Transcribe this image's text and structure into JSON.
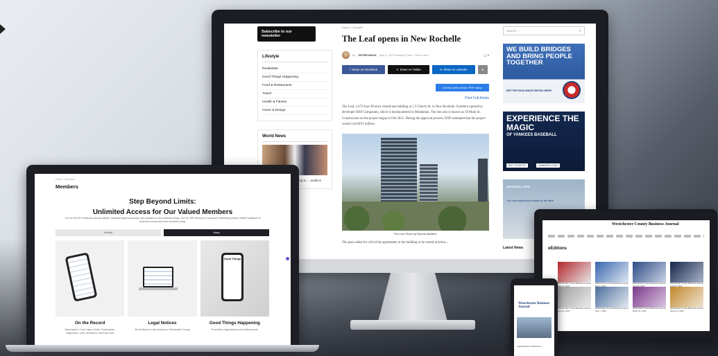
{
  "monitor": {
    "left_col": {
      "newsletter_button": "Subscribe to our newsletter",
      "lifestyle_title": "Lifestyle",
      "lifestyle_items": [
        "Realestate",
        "Good Things Happening",
        "Food & Restaurants",
        "Travel",
        "Health & Fitness",
        "Home & Design"
      ],
      "world_news_title": "World News",
      "world_news_snippet": "? ... how...lutchas ... reaching to ... audition"
    },
    "article": {
      "breadcrumb": "Home > Lifestyle",
      "headline": "The Leaf opens in New Rochelle",
      "byline_by": "By",
      "author": "PETER MAXX",
      "date_meta": "May 6, 2025  Reading Time: 2 mins read",
      "comments": "0",
      "share_facebook": "Share on Facebook",
      "share_twitter": "Share on Twitter",
      "share_linkedin": "Share on LinkedIn",
      "pdf_button": "Get the print version PDF today",
      "print_link": "Print Full Article",
      "paragraph1": "The Leaf, a 475-foot 28-story mixed-use building at 1.5 Church St. in New Rochelle. Southern opened by developer RXP Companies, which is headquartered in Manhattan. The site also is known as 50 Main St. Construction on the project began in Feb 2021. During the approval process, RXP estimated that the project would cost $195 million.",
      "image_caption": "The Leaf. Photo by Express Builders.",
      "paragraph2": "The plan called for 418 of the apartments in the building to be rented at below..."
    },
    "right_col": {
      "search_placeholder": "Search ...",
      "ad1_headline": "WE BUILD BRIDGES AND BRING PEOPLE TOGETHER",
      "ad1_sub": "BETTER BUILDINGS BEGIN HERE",
      "ad2_headline": "EXPERIENCE THE MAGIC",
      "ad2_sub": "OF YANKEES BASEBALL",
      "ad2_btn1": "BUY TICKETS",
      "ad2_btn2": "YANKEES.COM",
      "ad3_brand": "SUPERCELL RED",
      "ad3_sub": "Your new neighborhood awaits for the office",
      "latest_news": "Latest News"
    }
  },
  "laptop": {
    "breadcrumb": "Home > Members",
    "page_title": "Members",
    "headline_line1": "Step Beyond Limits:",
    "headline_line2": "Unlimited Access for Our Valued Members",
    "description": "Join for $19.99 / Business Journal articles, essential legal documents, and updates on new business filings. Join for 20% discount on exclusive networking events, limited invitations to exclusive events and more members today.",
    "tab_monthly": "Monthly",
    "tab_yearly": "Yearly",
    "cards": [
      {
        "label": "On the Record",
        "sub": "Bankruptcies, Court Cases, Deeds, Foreclosures, Judgements, Liens, Mechanic's Liens and more"
      },
      {
        "label": "Legal Notices",
        "sub": "All the filing for a new business in Westchester County"
      },
      {
        "label": "Good Things Happening",
        "sub": "Promotions, Appointments and Achievements"
      }
    ],
    "card3_cover": "Good Things"
  },
  "tablet": {
    "logo": "Westchester County Business Journal",
    "section_title": "eEditions",
    "issues": [
      "Westchester County Business Journal, May 12, 2025",
      "Westchester County Business Journal, May 5, 2025",
      "Westchester County Business Journal, April 28, 2025",
      "Westchester County Business Journal, April 21, 2025",
      "Westchester County Business Journal, April 14, 2025",
      "Westchester County Business Journal, April 7, 2025",
      "Westchester County Business Journal, March 31, 2025",
      "Westchester County Business Journal, March 24, 2025"
    ]
  },
  "phone": {
    "logo": "Westchester Business Journal",
    "snippet": "Legal Notices in Business..."
  },
  "colors": {
    "facebook": "#3b5998",
    "twitter": "#111111",
    "linkedin": "#0a66c2",
    "link_blue": "#1a63c7",
    "ad_navy": "#13284f",
    "accent_purple": "#6b4fd6"
  }
}
